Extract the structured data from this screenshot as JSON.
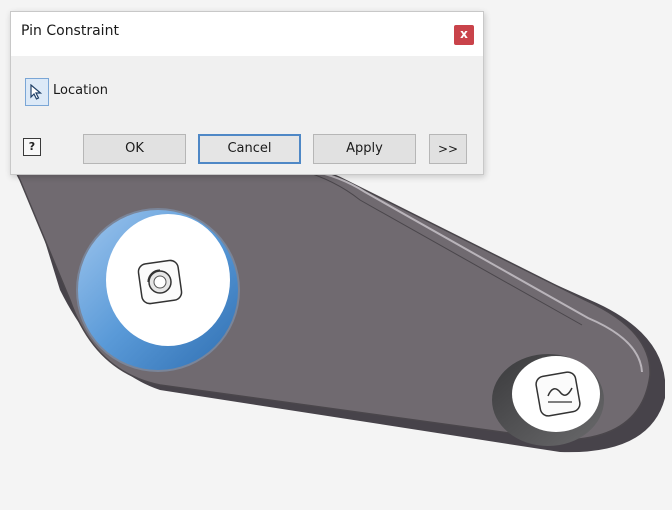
{
  "dialog": {
    "title": "Pin Constraint",
    "close_label": "x",
    "location_label": "Location",
    "help_label": "?",
    "ok_label": "OK",
    "cancel_label": "Cancel",
    "apply_label": "Apply",
    "more_label": ">>"
  },
  "colors": {
    "part_face": "#706a70",
    "part_edge": "#4a464b",
    "selection_highlight": "#4f8fd0",
    "close_button": "#c9434a",
    "dialog_bg": "#f0f0f0"
  },
  "icons": {
    "location": "cursor-arrow-icon",
    "pin_glyph": "pin-constraint-glyph-icon",
    "slot_glyph": "slot-constraint-glyph-icon"
  }
}
